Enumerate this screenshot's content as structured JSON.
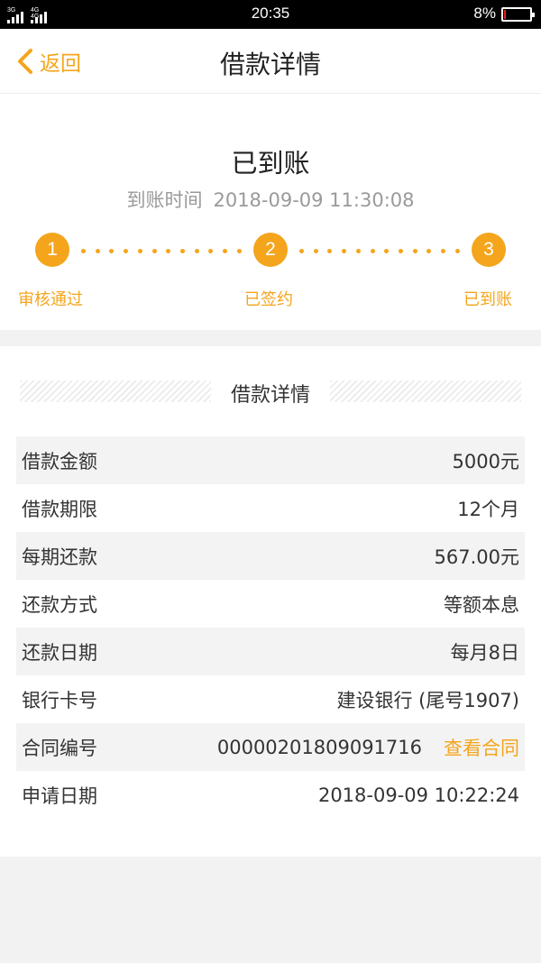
{
  "status_bar": {
    "signal1_tag": "3G",
    "signal2_tag": "4G 4G",
    "time": "20:35",
    "battery": "8%",
    "battery_level": 0.08
  },
  "nav": {
    "back_label": "返回",
    "title": "借款详情"
  },
  "status": {
    "title": "已到账",
    "time_label": "到账时间",
    "time_value": "2018-09-09 11:30:08",
    "steps": [
      {
        "num": "1",
        "label": "审核通过"
      },
      {
        "num": "2",
        "label": "已签约"
      },
      {
        "num": "3",
        "label": "已到账"
      }
    ]
  },
  "details": {
    "section_title": "借款详情",
    "rows": [
      {
        "label": "借款金额",
        "value": "5000元"
      },
      {
        "label": "借款期限",
        "value": "12个月"
      },
      {
        "label": "每期还款",
        "value": "567.00元"
      },
      {
        "label": "还款方式",
        "value": "等额本息"
      },
      {
        "label": "还款日期",
        "value": "每月8日"
      },
      {
        "label": "银行卡号",
        "value": "建设银行 (尾号1907)"
      },
      {
        "label": "合同编号",
        "value": "00000201809091716",
        "link": "查看合同"
      },
      {
        "label": "申请日期",
        "value": "2018-09-09 10:22:24"
      }
    ]
  },
  "colors": {
    "accent": "#f4a51c",
    "battery_low": "#e02020"
  }
}
